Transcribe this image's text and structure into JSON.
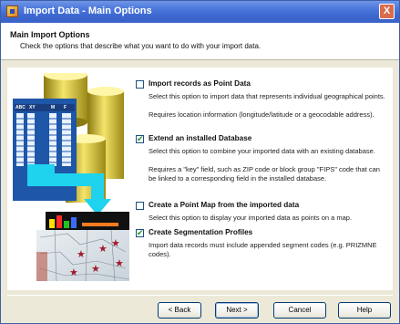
{
  "window": {
    "title": "Import Data - Main Options",
    "close_label": "X"
  },
  "header": {
    "title": "Main Import Options",
    "subtitle": "Check the options that describe what you want to do with your import data."
  },
  "illustration": {
    "table_labels": [
      "ABC",
      "XY",
      "M",
      "F"
    ]
  },
  "options": [
    {
      "label": "Import records as  Point Data",
      "checked": false,
      "desc": [
        "Select this option to import data that represents individual geographical points.",
        "Requires location information (longitude/latitude or a geocodable address)."
      ]
    },
    {
      "label": "Extend an installed Database",
      "checked": true,
      "desc": [
        "Select this option to combine your imported data with an existing database.",
        "Requires a \"key\" field, such as ZIP code or block group \"FIPS\" code that can be linked to a corresponding field in the installed database."
      ]
    },
    {
      "label": "Create a Point Map from the imported data",
      "checked": false,
      "desc": [
        "Select this option to display your imported data as points on a map."
      ]
    },
    {
      "label": "Create Segmentation Profiles",
      "checked": true,
      "desc": [
        "Import data records must include appended segment codes (e.g. PRIZMNE codes)."
      ]
    }
  ],
  "buttons": {
    "back": "< Back",
    "next": "Next >",
    "cancel": "Cancel",
    "help": "Help"
  },
  "colors": {
    "title_bar": "#3c66cf",
    "accent_cyan": "#1fd3ef",
    "dialog_bg": "#ece9d8"
  }
}
